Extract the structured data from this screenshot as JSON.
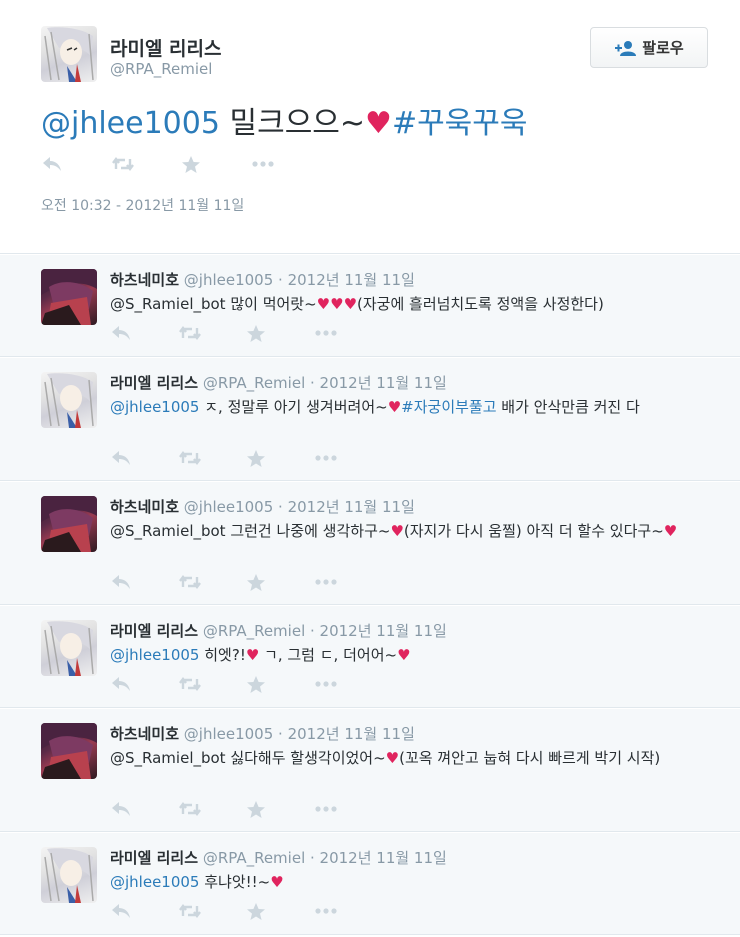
{
  "main": {
    "name": "라미엘 리리스",
    "handle": "@RPA_Remiel",
    "follow_label": "팔로우",
    "text_mention": "@jhlee1005",
    "text_body": " 밀크으으~",
    "text_heart": "♥",
    "text_hashtag": "#꾸욱꾸욱",
    "timestamp": "오전 10:32 - 2012년 11월 11일",
    "icons": [
      "reply-icon",
      "retweet-icon",
      "favorite-icon",
      "more-icon"
    ]
  },
  "replies": [
    {
      "name": "하츠네미호",
      "handle": "@jhlee1005",
      "date": " · 2012년 11월 11일",
      "lead": "@S_Ramiel_bot 많이 먹어랏~",
      "hearts": "♥♥♥",
      "rest": "(자궁에 흘러넘치도록 정액을 사정한다)"
    },
    {
      "name": "라미엘 리리스",
      "handle": "@RPA_Remiel",
      "date": " · 2012년 11월 11일",
      "mention": "@jhlee1005",
      "lead": " ㅈ, 정말루 아기 생겨버려어~",
      "heart": "♥",
      "hashtag": "#자궁이부풀고",
      "rest": " 배가 안삭만큼 커진 다"
    },
    {
      "name": "하츠네미호",
      "handle": "@jhlee1005",
      "date": " · 2012년 11월 11일",
      "lead": "@S_Ramiel_bot 그런건 나중에 생각하구~",
      "heart": "♥",
      "rest": "(자지가 다시 움찔) 아직 더 할수 있다구~",
      "heart2": "♥"
    },
    {
      "name": "라미엘 리리스",
      "handle": "@RPA_Remiel",
      "date": " · 2012년 11월 11일",
      "mention": "@jhlee1005",
      "lead": " 히엣?!",
      "heart": "♥",
      "rest": " ㄱ, 그럼 ㄷ, 더어어~",
      "heart2": "♥"
    },
    {
      "name": "하츠네미호",
      "handle": "@jhlee1005",
      "date": " · 2012년 11월 11일",
      "lead": "@S_Ramiel_bot 싫다해두 할생각이었어~",
      "heart": "♥",
      "rest": "(꼬옥 껴안고 눕혀 다시 빠르게 박기 시작)"
    },
    {
      "name": "라미엘 리리스",
      "handle": "@RPA_Remiel",
      "date": " · 2012년 11월 11일",
      "mention": "@jhlee1005",
      "lead": " 후냐앗!!~",
      "heart": "♥"
    }
  ],
  "colors": {
    "link": "#2b7bb9",
    "heart": "#e0245e",
    "muted": "#8899a6",
    "reply_bg": "#f5f8fa"
  }
}
